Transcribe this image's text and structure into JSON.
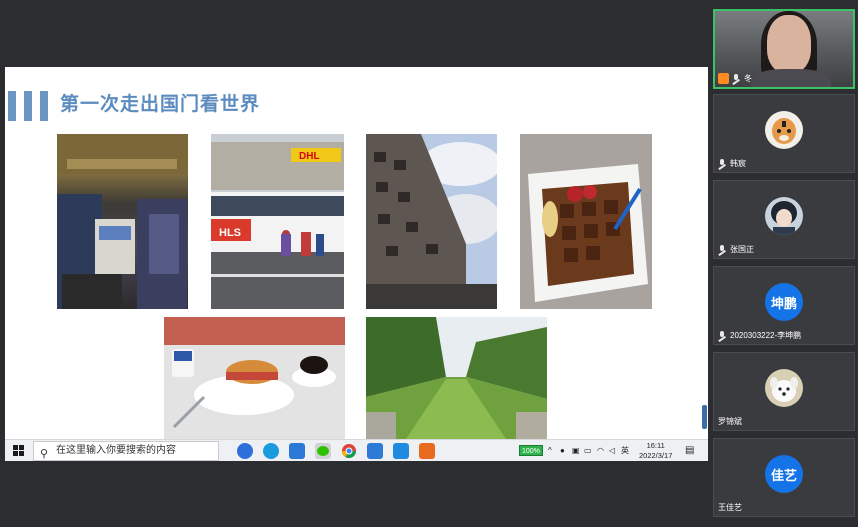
{
  "slide": {
    "title": "第一次走出国门看世界",
    "photos": [
      {
        "label": "airplane-cabin-photo"
      },
      {
        "label": "dhl-bus-photo"
      },
      {
        "label": "building-photo"
      },
      {
        "label": "waffle-photo"
      },
      {
        "label": "breakfast-photo"
      },
      {
        "label": "park-avenue-photo"
      }
    ],
    "dhl_text": "DHL",
    "bus_text": "HLS"
  },
  "taskbar": {
    "search_placeholder": "在这里输入你要搜索的内容",
    "battery": "100%",
    "ime": "英",
    "time": "16:11",
    "date": "2022/3/17"
  },
  "participants": {
    "self": {
      "label": "冬"
    },
    "list": [
      {
        "name": "韩宸",
        "avatar": "tiger"
      },
      {
        "name": "张国正",
        "avatar": "anime-character"
      },
      {
        "name": "2020303222-李坤鹏",
        "avatar_text": "坤鹏"
      },
      {
        "name": "罗锦斌",
        "avatar": "dog"
      },
      {
        "name": "王佳艺",
        "avatar_text": "佳艺"
      }
    ]
  },
  "colors": {
    "title": "#5c8bbf",
    "accent_bars": "#6b96c4",
    "avatar_blue": "#1473e6",
    "active_speaker": "#3cc36a"
  }
}
